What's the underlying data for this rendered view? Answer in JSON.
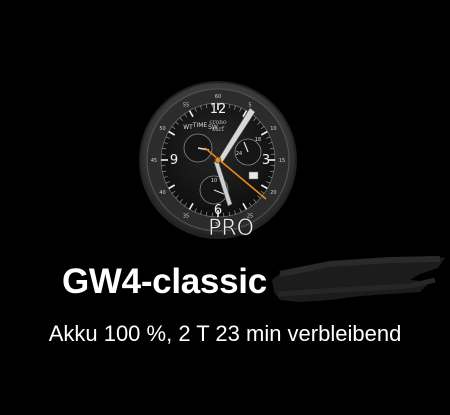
{
  "device": {
    "name": "GW4-classic",
    "battery_status": "Akku 100 %, 2 T 23 min verbleibend"
  },
  "watch_face": {
    "badge": "PRO",
    "brand_line1": "crono",
    "brand_line2": "surf",
    "numerals": {
      "n12": "12",
      "n3": "3",
      "n6": "6",
      "n9": "9"
    },
    "subdial_labels": {
      "wt": "WT",
      "time": "TIME",
      "sw": "SW"
    },
    "subdial_numbers": {
      "s10": "10",
      "s18": "18",
      "s24": "24"
    },
    "bezel_numbers": [
      "60",
      "5",
      "10",
      "15",
      "20",
      "25",
      "30",
      "35",
      "40",
      "45",
      "50",
      "55"
    ],
    "icon": "watch-face-preview-icon"
  },
  "colors": {
    "background": "#000000",
    "text": "#ffffff",
    "accent_hand": "#e8891a"
  }
}
